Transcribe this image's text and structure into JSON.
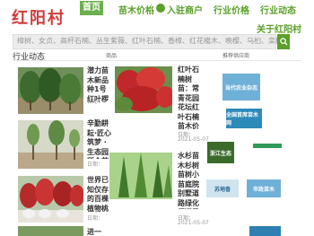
{
  "logo_text": "红阳村",
  "nav": {
    "home": "首页",
    "prices": "苗木价格",
    "login": "入驻商户",
    "industry_prices": "行业价格",
    "industry_news": "行业动态",
    "about": "关于红阳村"
  },
  "search": {
    "placeholder": "樟树、女贞、高杆石楠、丛生紫薇、红叶石楠、香樟、红花檵木、晚樱、乌桕、栾树"
  },
  "section": {
    "left": "行业动态",
    "mid": "商品",
    "right": "推荐供应商"
  },
  "articles": [
    {
      "title": "潜力苗木新品种1号红叶椤 号红叶椤",
      "meta": "日期："
    },
    {
      "title": "红叶石楠树苗：常青花园花坛红叶石楠苗木价格喷薯苏观叶植物",
      "meta": "2021-05-07"
    },
    {
      "title": "辛勤耕耘·匠心筑梦 · 生态园所个苗事业最新资讯 \"园艺\"",
      "meta": "日期："
    },
    {
      "title": "水杉苗木杉树苗树小苗庭院别墅道路绿化行道风景树南北方均可种植",
      "meta": "2021-05-07"
    },
    {
      "title": "世界已知仅存的百棵植物桃花林区科技发布会点云南文",
      "meta": "日期："
    },
    {
      "title": "进一",
      "meta": ""
    }
  ],
  "ads": [
    {
      "label": "当代农业杂志"
    },
    {
      "label": "全国首席苗木网"
    },
    {
      "label": "浙江生态"
    },
    {
      "label": "苏地香"
    },
    {
      "label": "市政苗木"
    }
  ],
  "colors": {
    "accent": "#5aa02a",
    "logo": "#cf3c3c",
    "nav_active_bg": "#6ab04c"
  }
}
